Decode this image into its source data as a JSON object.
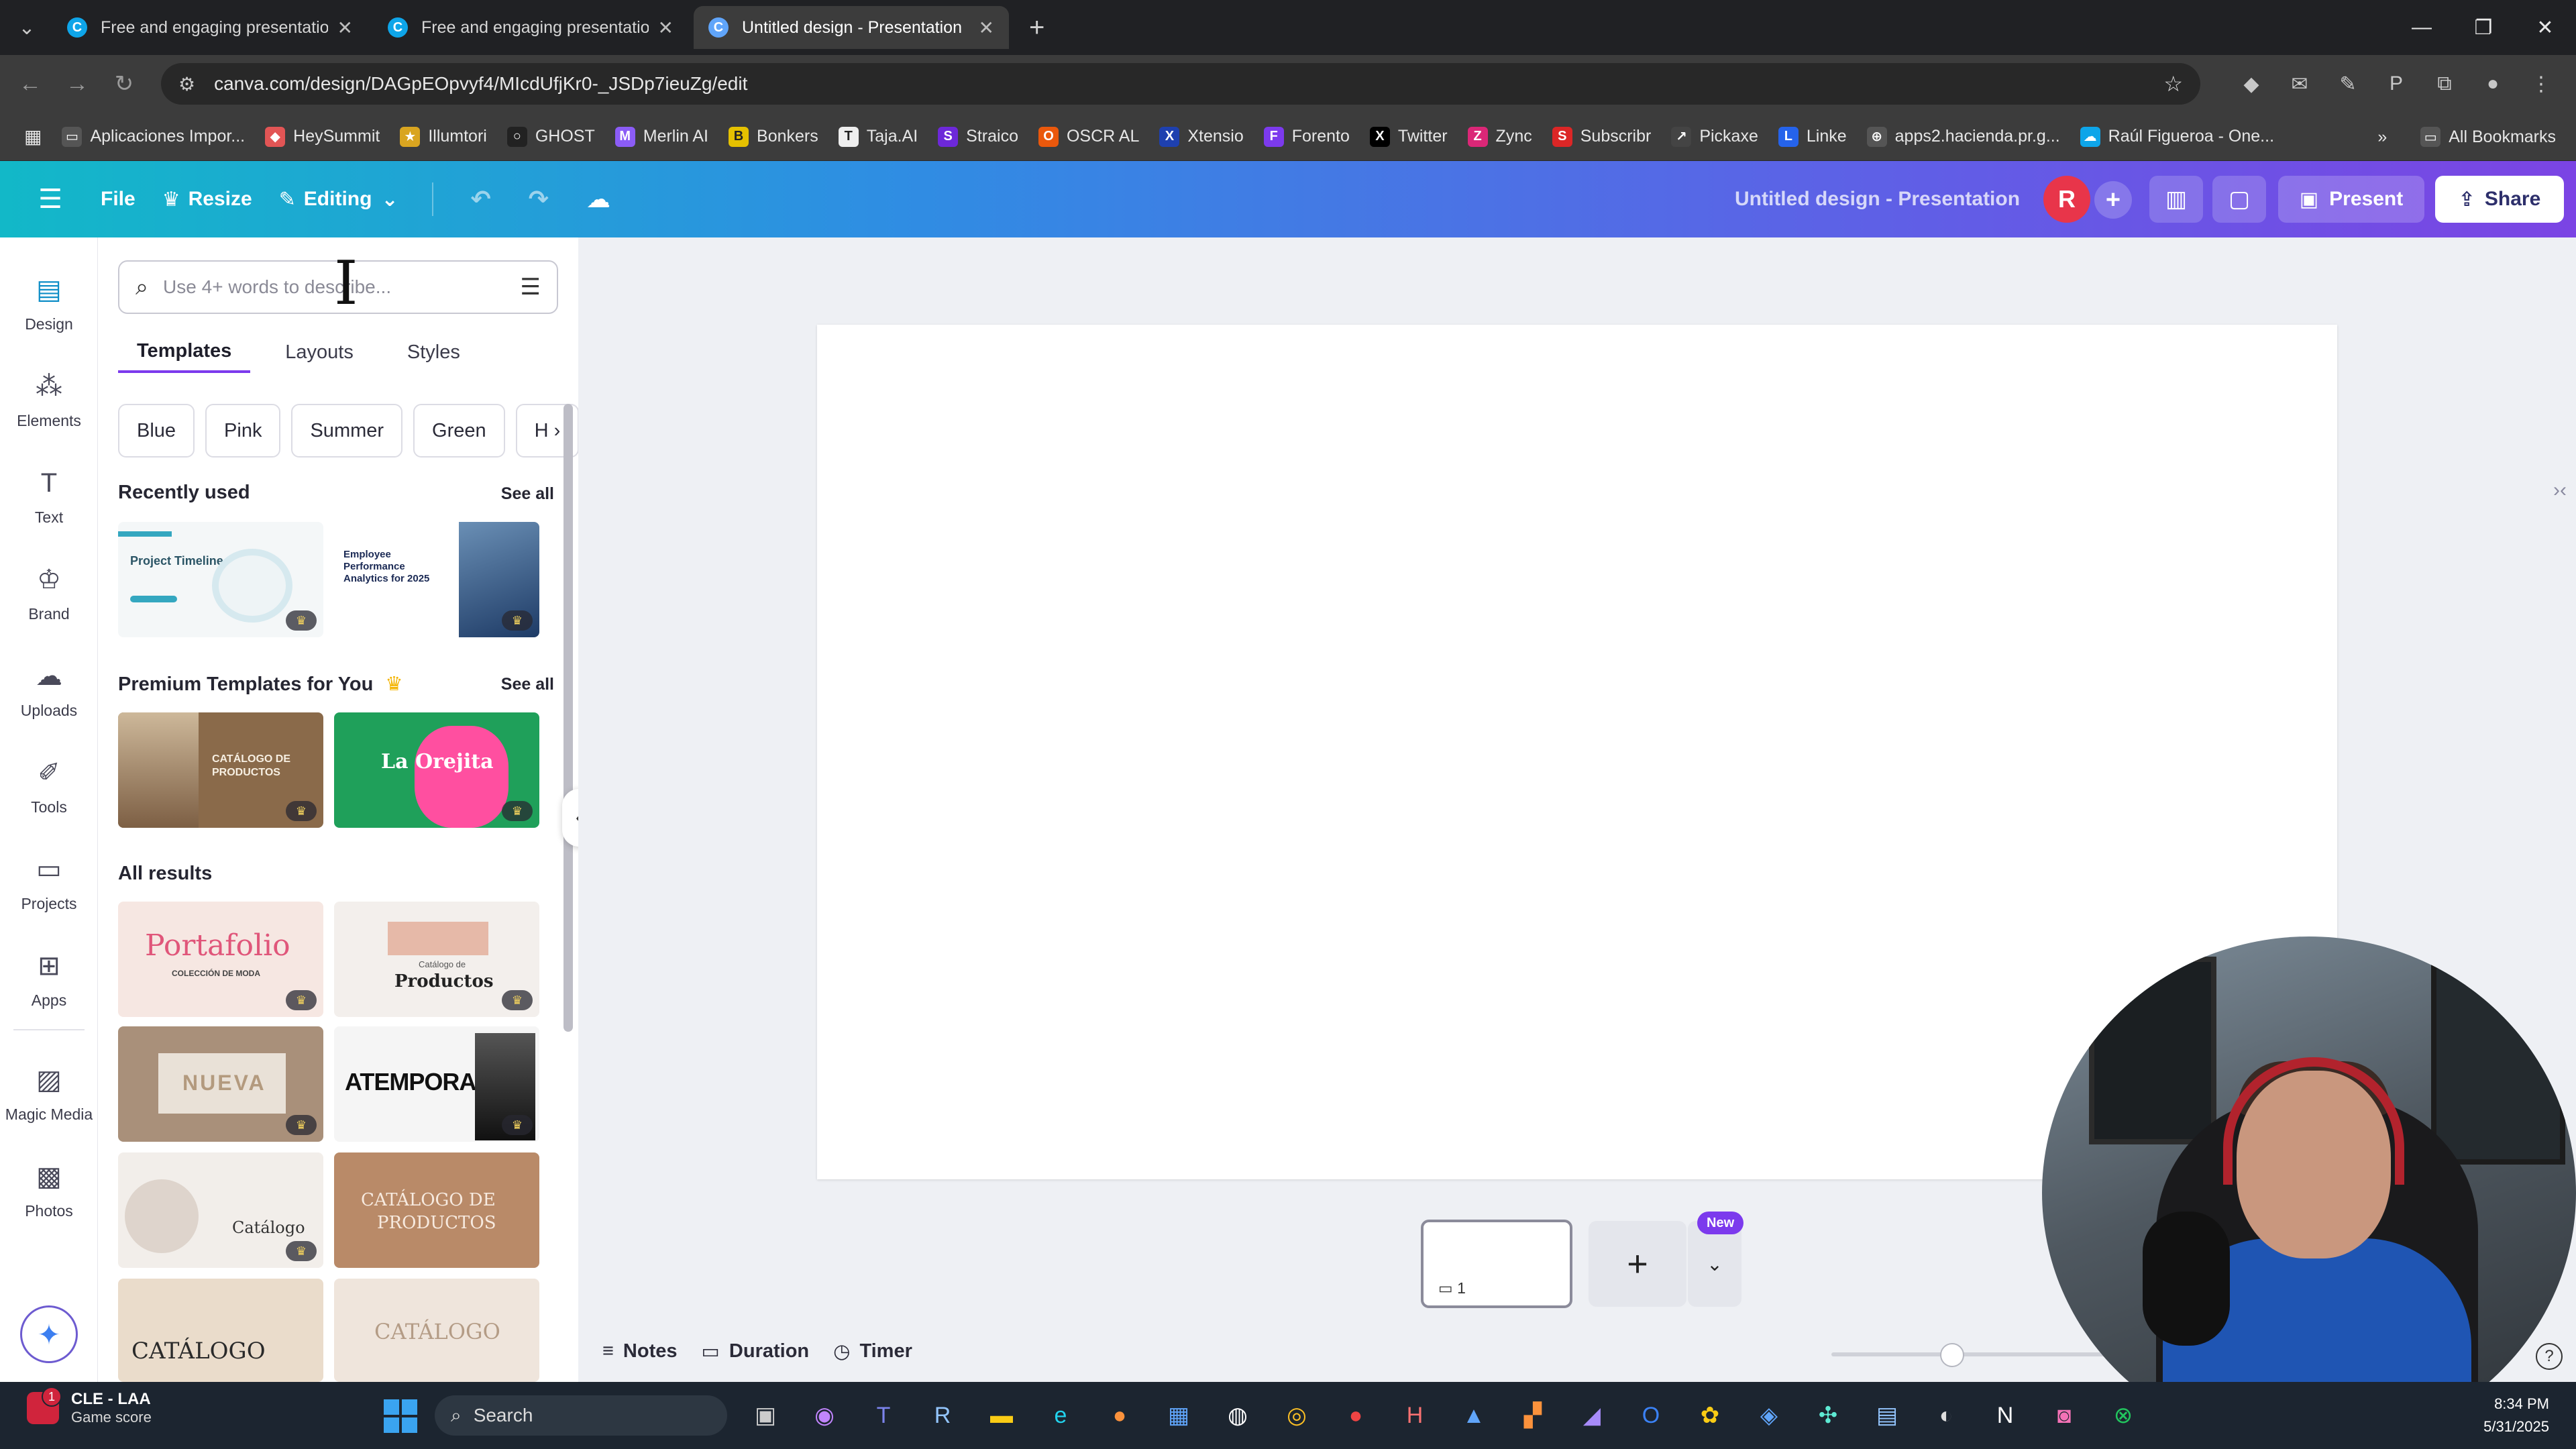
{
  "browser": {
    "tabs": [
      {
        "title": "Free and engaging presentation",
        "active": false,
        "favicon": "canva-icon"
      },
      {
        "title": "Free and engaging presentation",
        "active": false,
        "favicon": "canva-icon"
      },
      {
        "title": "Untitled design - Presentation",
        "active": true,
        "favicon": "canva-icon"
      }
    ],
    "url": "canva.com/design/DAGpEOpvyf4/MIcdUfjKr0-_JSDp7ieuZg/edit",
    "bookmarks": [
      "Aplicaciones Impor...",
      "HeySummit",
      "Illumtori",
      "GHOST",
      "Merlin AI",
      "Bonkers",
      "Taja.AI",
      "Straico",
      "OSCR AL",
      "Xtensio",
      "Forento",
      "Twitter",
      "Zync",
      "Subscribr",
      "Pickaxe",
      "Linke",
      "apps2.hacienda.pr.g...",
      "Raúl Figueroa - One..."
    ],
    "all_bookmarks": "All Bookmarks"
  },
  "header": {
    "file": "File",
    "resize": "Resize",
    "editing": "Editing",
    "design_title": "Untitled design - Presentation",
    "avatar_initial": "R",
    "present": "Present",
    "share": "Share"
  },
  "rail": {
    "items": [
      "Design",
      "Elements",
      "Text",
      "Brand",
      "Uploads",
      "Tools",
      "Projects",
      "Apps",
      "Magic Media",
      "Photos"
    ]
  },
  "panel": {
    "search_placeholder": "Use 4+ words to describe...",
    "tabs": [
      "Templates",
      "Layouts",
      "Styles"
    ],
    "chips": [
      "Blue",
      "Pink",
      "Summer",
      "Green",
      "H"
    ],
    "recently_used": "Recently used",
    "premium": "Premium Templates for You",
    "see_all": "See all",
    "all_results": "All results",
    "thumbs": {
      "recent1": "Project Timeline",
      "recent2": "Employee Performance Analytics for 2025",
      "premium1": "CATÁLOGO DE PRODUCTOS",
      "premium2": "La Orejita",
      "r1": "Portafolio",
      "r1b": "COLECCIÓN DE MODA",
      "r2a": "Catálogo de",
      "r2b": "Productos",
      "r3": "NUEVA",
      "r4": "ATEMPORAL",
      "r5": "Catálogo",
      "r6a": "CATÁLOGO DE",
      "r6b": "PRODUCTOS",
      "r7": "CATÁLOGO",
      "r8": "CATÁLOGO"
    }
  },
  "canvas": {
    "page_count": "1",
    "new_badge": "New",
    "notes": "Notes",
    "duration": "Duration",
    "timer": "Timer",
    "zoom_fraction": 0.41
  },
  "taskbar": {
    "game_title": "CLE - LAA",
    "game_sub": "Game score",
    "game_badge": "1",
    "search": "Search",
    "time": "8:34 PM",
    "date": "5/31/2025"
  }
}
